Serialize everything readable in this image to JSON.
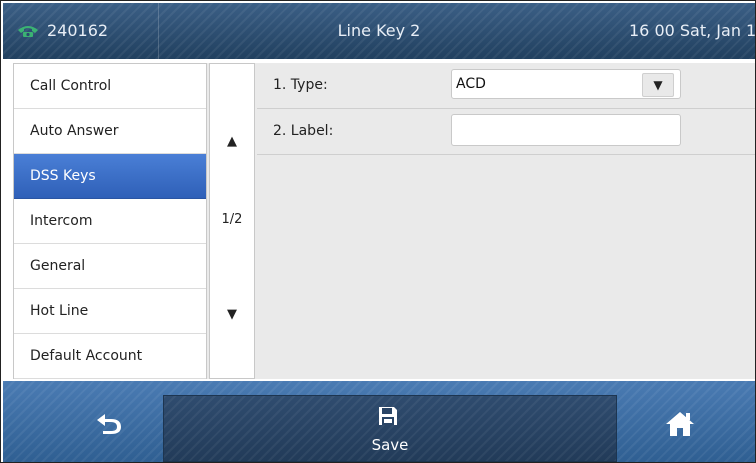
{
  "topbar": {
    "extension": "240162",
    "title": "Line Key 2",
    "clock": "16 00 Sat, Jan 14"
  },
  "sidebar": {
    "items": [
      {
        "label": "Call Control"
      },
      {
        "label": "Auto Answer"
      },
      {
        "label": "DSS Keys",
        "active": true
      },
      {
        "label": "Intercom"
      },
      {
        "label": "General"
      },
      {
        "label": "Hot Line"
      },
      {
        "label": "Default Account"
      }
    ]
  },
  "pager": {
    "page": "1/2",
    "up_icon": "triangle-up",
    "down_icon": "triangle-down"
  },
  "form": {
    "type_label": "1. Type:",
    "type_value": "ACD",
    "label_label": "2. Label:",
    "label_value": ""
  },
  "bottombar": {
    "back_icon": "back-arrow",
    "save_label": "Save",
    "save_icon": "floppy-disk",
    "home_icon": "home"
  },
  "colors": {
    "accent_active": "#3a6fcc",
    "bar_blue": "#3b5f86",
    "phone_green": "#3bb273"
  }
}
